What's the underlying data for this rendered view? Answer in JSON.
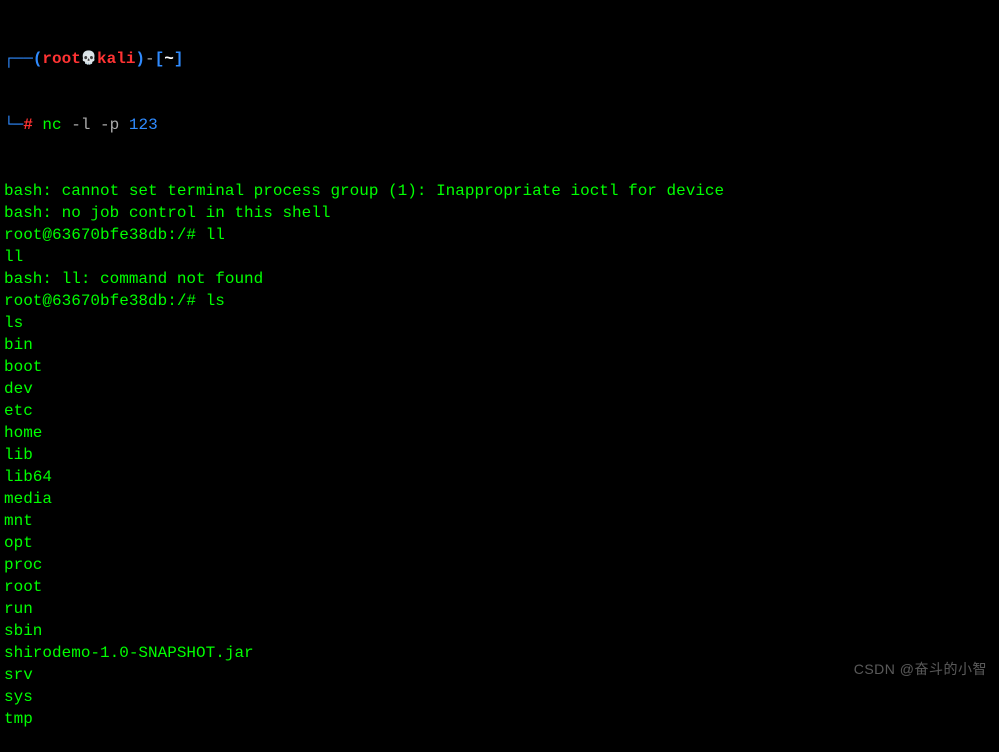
{
  "prompt": {
    "dash_prefix": "┌──",
    "paren_open": "(",
    "user": "root",
    "skull": "💀",
    "host": "kali",
    "paren_close": ")",
    "dash_mid": "-",
    "path_open": "[",
    "path": "~",
    "path_close": "]",
    "line2_prefix": "└─",
    "hash": "#",
    "cmd_bin": "nc",
    "cmd_args": "-l -p",
    "cmd_port": "123"
  },
  "output_lines": [
    "bash: cannot set terminal process group (1): Inappropriate ioctl for device",
    "bash: no job control in this shell",
    "root@63670bfe38db:/# ll",
    "ll",
    "bash: ll: command not found",
    "root@63670bfe38db:/# ls",
    "ls",
    "bin",
    "boot",
    "dev",
    "etc",
    "home",
    "lib",
    "lib64",
    "media",
    "mnt",
    "opt",
    "proc",
    "root",
    "run",
    "sbin",
    "shirodemo-1.0-SNAPSHOT.jar",
    "srv",
    "sys",
    "tmp"
  ],
  "watermark": "CSDN @奋斗的小智"
}
